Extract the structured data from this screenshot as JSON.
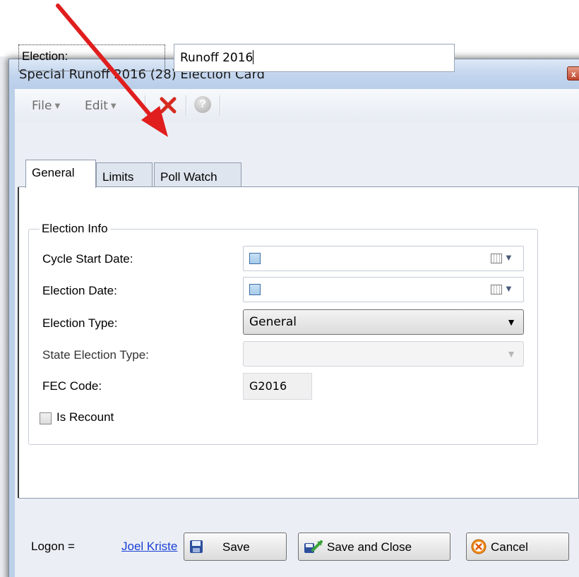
{
  "window": {
    "title": "Special Runoff 2016 (28) Election Card",
    "close_glyph": "x"
  },
  "toolbar": {
    "file_label": "File",
    "edit_label": "Edit",
    "help_glyph": "?"
  },
  "election": {
    "label": "Election:",
    "value": "Runoff 2016"
  },
  "tabs": [
    {
      "label": "General",
      "active": true
    },
    {
      "label": "Limits",
      "active": false
    },
    {
      "label": "Poll Watch",
      "active": false
    }
  ],
  "election_info": {
    "group_title": "Election Info",
    "cycle_start_date_label": "Cycle Start Date:",
    "election_date_label": "Election Date:",
    "election_type_label": "Election Type:",
    "election_type_value": "General",
    "state_election_type_label": "State Election Type:",
    "state_election_type_value": "",
    "fec_code_label": "FEC Code:",
    "fec_code_value": "G2016",
    "is_recount_label": "Is Recount",
    "is_recount_checked": false
  },
  "footer": {
    "logon_label": "Logon =",
    "logon_user": "Joel Kriste",
    "save_label": "Save",
    "save_close_label": "Save and Close",
    "cancel_label": "Cancel"
  },
  "colors": {
    "annotation_arrow": "#e01e1e",
    "link": "#1a3fd4"
  }
}
